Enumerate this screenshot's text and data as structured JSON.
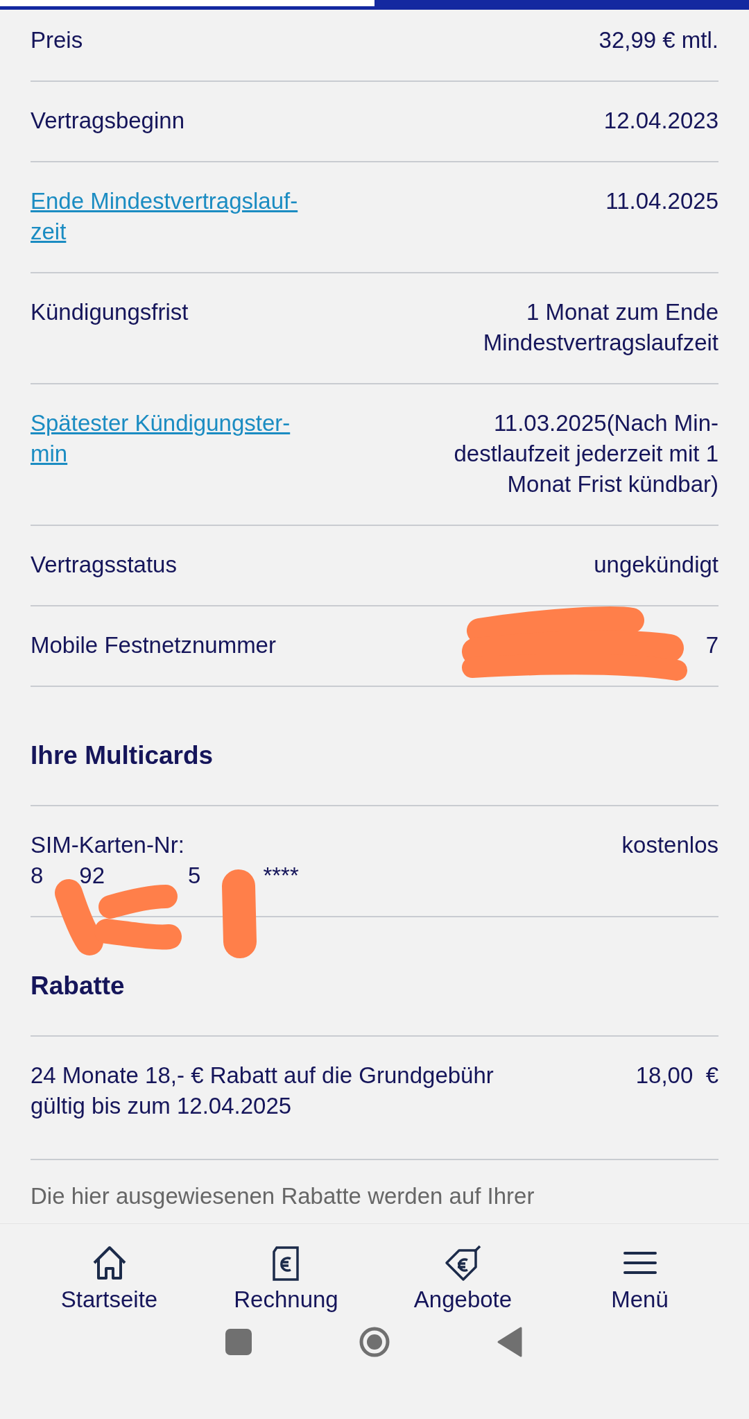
{
  "details": [
    {
      "label": "Preis",
      "kind": "text",
      "value": "32,99 € mtl."
    },
    {
      "label": "Vertragsbeginn",
      "kind": "text",
      "value": "12.04.2023"
    },
    {
      "label": "Ende Mindestvertragslauf-\nzeit",
      "kind": "link",
      "value": "11.04.2025"
    },
    {
      "label": "Kündigungsfrist",
      "kind": "text",
      "value": "1 Monat zum Ende\nMindestvertragslaufzeit"
    },
    {
      "label": "Spätester Kündigungster-\nmin",
      "kind": "link",
      "value": "11.03.2025(Nach Min-\ndestlaufzeit jederzeit mit 1\nMonat Frist kündbar)"
    },
    {
      "label": "Vertragsstatus",
      "kind": "text",
      "value": "ungekündigt"
    },
    {
      "label": "Mobile Festnetznummer",
      "kind": "redacted",
      "value": "7"
    }
  ],
  "multicards": {
    "title": "Ihre Multicards",
    "label": "SIM-Karten-Nr:",
    "number_fragments": [
      "8",
      "92",
      "5",
      "****"
    ],
    "value": "kostenlos"
  },
  "rabatte": {
    "title": "Rabatte",
    "items": [
      {
        "text": "24 Monate 18,- € Rabatt auf die Grundgebühr\ngültig bis zum 12.04.2025",
        "amount": "18,00  €"
      }
    ],
    "note": "Die hier ausgewiesenen Rabatte werden auf Ihrer"
  },
  "bottom_nav": [
    {
      "label": "Startseite"
    },
    {
      "label": "Rechnung"
    },
    {
      "label": "Angebote"
    },
    {
      "label": "Menü"
    }
  ]
}
